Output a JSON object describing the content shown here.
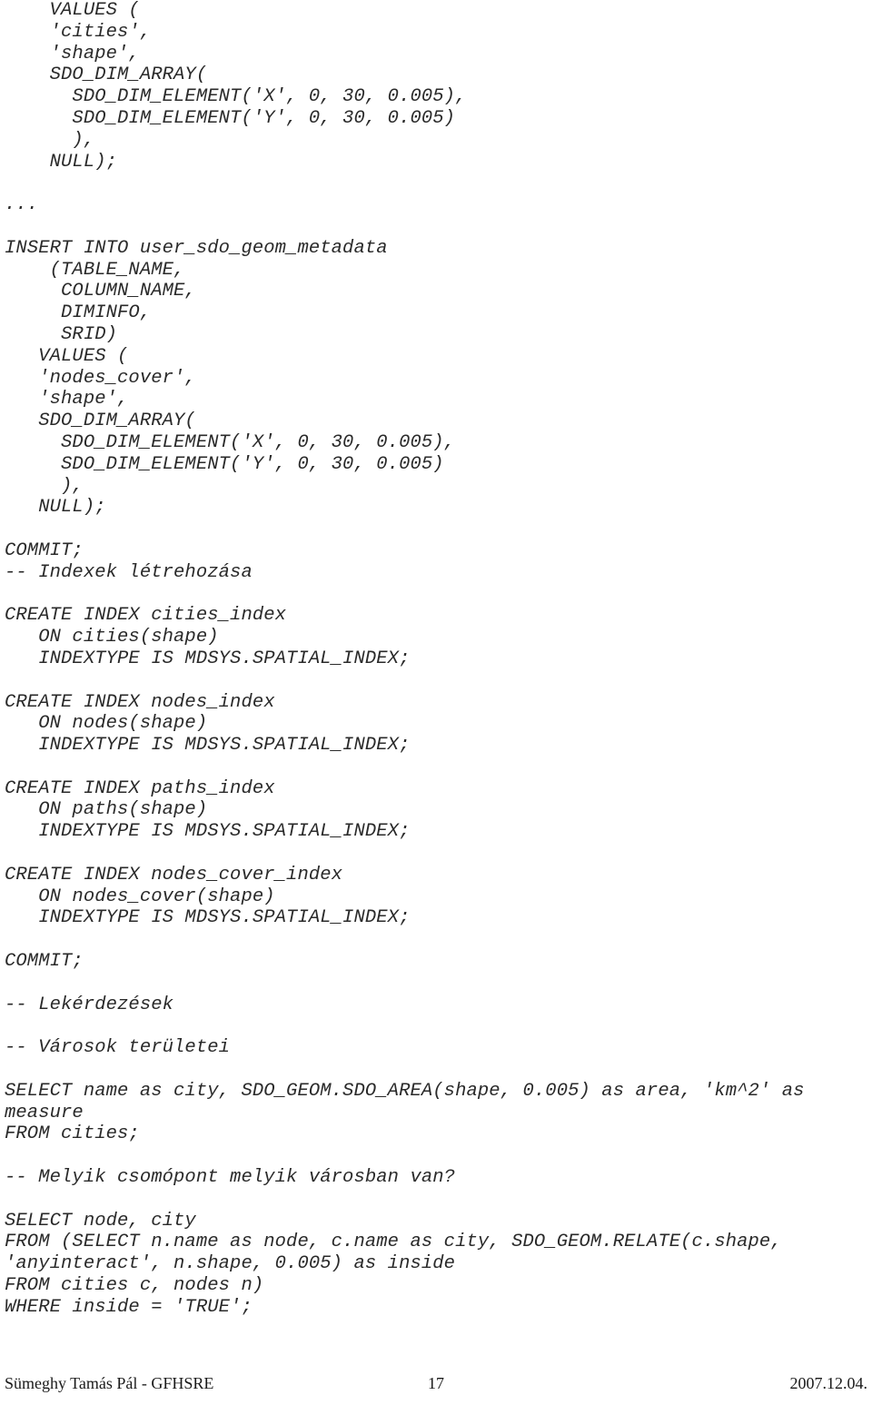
{
  "document": {
    "page_number": "17",
    "footer": {
      "left": "Sümeghy Tamás Pál - GFHSRE",
      "center": "17",
      "right": "2007.12.04."
    }
  },
  "code": {
    "lines": [
      "    VALUES (",
      "    'cities',",
      "    'shape',",
      "    SDO_DIM_ARRAY(",
      "      SDO_DIM_ELEMENT('X', 0, 30, 0.005),",
      "      SDO_DIM_ELEMENT('Y', 0, 30, 0.005)",
      "      ),",
      "    NULL);",
      "",
      "...",
      "",
      "INSERT INTO user_sdo_geom_metadata",
      "    (TABLE_NAME,",
      "     COLUMN_NAME,",
      "     DIMINFO,",
      "     SRID)",
      "   VALUES (",
      "   'nodes_cover',",
      "   'shape',",
      "   SDO_DIM_ARRAY(",
      "     SDO_DIM_ELEMENT('X', 0, 30, 0.005),",
      "     SDO_DIM_ELEMENT('Y', 0, 30, 0.005)",
      "     ),",
      "   NULL);",
      "",
      "COMMIT;",
      "-- Indexek létrehozása",
      "",
      "CREATE INDEX cities_index",
      "   ON cities(shape)",
      "   INDEXTYPE IS MDSYS.SPATIAL_INDEX;",
      "",
      "CREATE INDEX nodes_index",
      "   ON nodes(shape)",
      "   INDEXTYPE IS MDSYS.SPATIAL_INDEX;",
      "",
      "CREATE INDEX paths_index",
      "   ON paths(shape)",
      "   INDEXTYPE IS MDSYS.SPATIAL_INDEX;",
      "",
      "CREATE INDEX nodes_cover_index",
      "   ON nodes_cover(shape)",
      "   INDEXTYPE IS MDSYS.SPATIAL_INDEX;",
      "",
      "COMMIT;",
      "",
      "-- Lekérdezések",
      "",
      "-- Városok területei",
      "",
      "SELECT name as city, SDO_GEOM.SDO_AREA(shape, 0.005) as area, 'km^2' as measure",
      "FROM cities;",
      "",
      "-- Melyik csomópont melyik városban van?",
      "",
      "SELECT node, city",
      "FROM (SELECT n.name as node, c.name as city, SDO_GEOM.RELATE(c.shape, 'anyinteract', n.shape, 0.005) as inside",
      "FROM cities c, nodes n)",
      "WHERE inside = 'TRUE';"
    ]
  }
}
